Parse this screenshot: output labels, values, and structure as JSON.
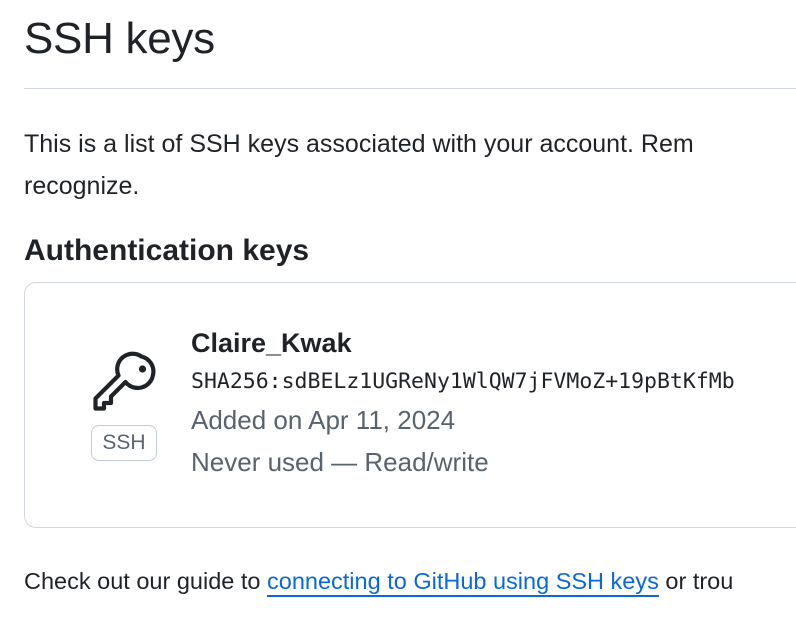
{
  "page": {
    "title": "SSH keys",
    "intro_line1": "This is a list of SSH keys associated with your account. Rem",
    "intro_line2": "recognize."
  },
  "auth_section": {
    "heading": "Authentication keys"
  },
  "keys": [
    {
      "icon": "key-icon",
      "badge": "SSH",
      "title": "Claire_Kwak",
      "fingerprint": "SHA256:sdBELz1UGReNy1WlQW7jFVMoZ+19pBtKfMb",
      "added": "Added on Apr 11, 2024",
      "usage": "Never used — Read/write"
    }
  ],
  "footer": {
    "prefix": "Check out our guide to ",
    "link_text": "connecting to GitHub using SSH keys",
    "suffix": " or trou"
  },
  "colors": {
    "text": "#1f2328",
    "muted": "#59636e",
    "border": "#d0d7de",
    "link": "#0969da"
  }
}
